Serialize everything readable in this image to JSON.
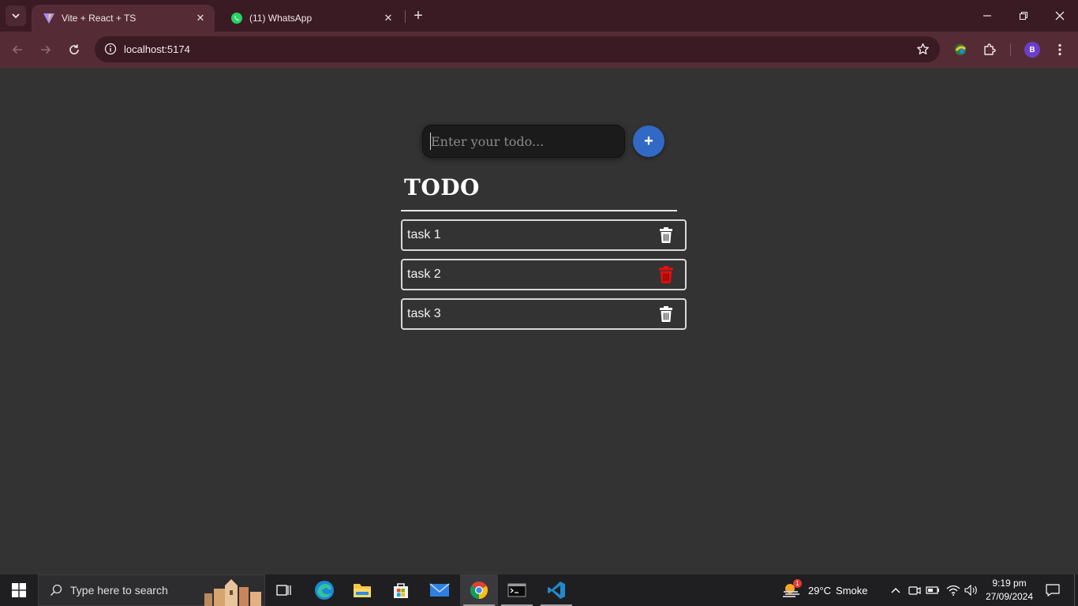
{
  "browser": {
    "tabs": [
      {
        "title": "Vite + React + TS",
        "favicon": "vite-icon",
        "active": true
      },
      {
        "title": "(11) WhatsApp",
        "favicon": "whatsapp-icon",
        "active": false
      }
    ],
    "url": "localhost:5174",
    "profile_initial": "B",
    "colors": {
      "frame": "#3a1b23",
      "toolbar": "#552c36"
    }
  },
  "app": {
    "input_placeholder": "Enter your todo...",
    "input_value": "",
    "add_label": "+",
    "heading": "TODO",
    "todos": [
      {
        "text": "task 1",
        "delete_icon": "trash-icon",
        "delete_color": "#ffffff"
      },
      {
        "text": "task 2",
        "delete_icon": "trash-icon",
        "delete_color": "#e01010"
      },
      {
        "text": "task 3",
        "delete_icon": "trash-icon",
        "delete_color": "#ffffff"
      }
    ],
    "colors": {
      "background": "#333333",
      "accent": "#3269c4"
    }
  },
  "taskbar": {
    "search_placeholder": "Type here to search",
    "apps": [
      "task-view-icon",
      "edge-icon",
      "file-explorer-icon",
      "microsoft-store-icon",
      "mail-icon",
      "chrome-icon",
      "terminal-icon",
      "vscode-icon"
    ],
    "weather": {
      "badge": "1",
      "temperature": "29°C",
      "condition": "Smoke"
    },
    "time": "9:19 pm",
    "date": "27/09/2024"
  }
}
